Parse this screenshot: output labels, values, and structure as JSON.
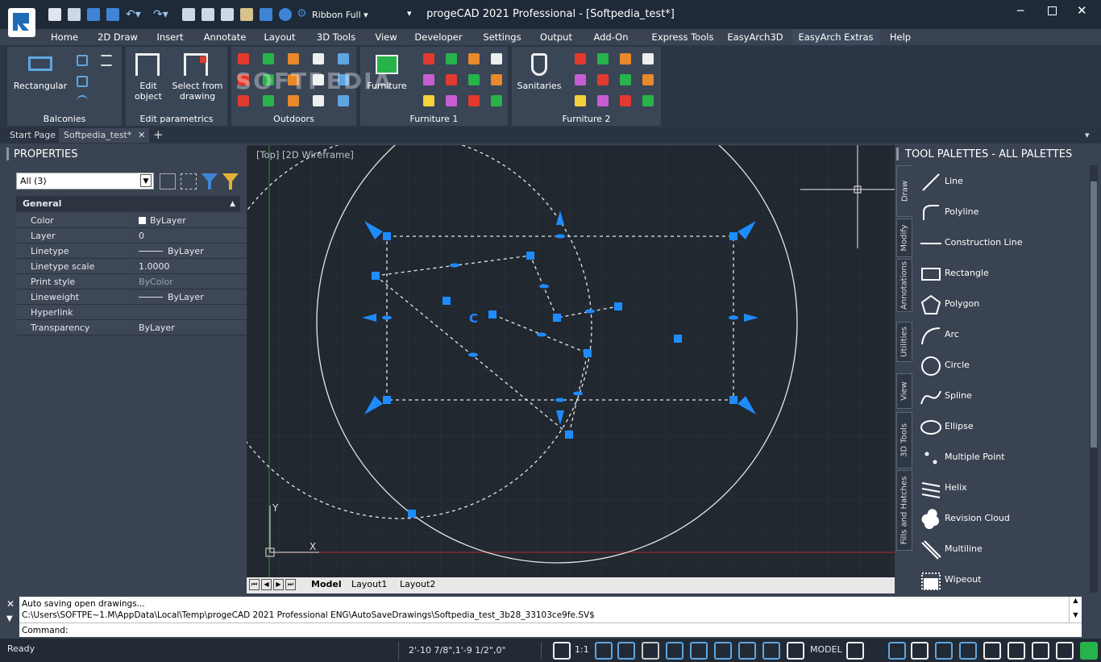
{
  "app": {
    "title": "progeCAD 2021 Professional - [Softpedia_test*]",
    "ribbon_mode": "Ribbon Full"
  },
  "menu": [
    "Home",
    "2D Draw",
    "Insert",
    "Annotate",
    "Layout",
    "3D Tools",
    "View",
    "Developer",
    "Settings",
    "Output",
    "Add-On",
    "Express Tools",
    "EasyArch3D",
    "EasyArch Extras",
    "Help"
  ],
  "ribbon": {
    "balconies": {
      "label": "Balconies",
      "big": "Rectangular"
    },
    "edit": {
      "label": "Edit parametrics",
      "b1": "Edit object",
      "b2": "Select from drawing"
    },
    "outdoors": {
      "label": "Outdoors"
    },
    "furn1": {
      "label": "Furniture 1",
      "big": "Furniture"
    },
    "furn2": {
      "label": "Furniture 2",
      "big": "Sanitaries"
    }
  },
  "watermark": "SOFTPEDIA",
  "doctabs": {
    "start": "Start Page",
    "doc": "Softpedia_test*"
  },
  "properties": {
    "title": "PROPERTIES",
    "selection": "All (3)",
    "section": "General",
    "rows": [
      {
        "k": "Color",
        "v": "ByLayer"
      },
      {
        "k": "Layer",
        "v": "0"
      },
      {
        "k": "Linetype",
        "v": "ByLayer"
      },
      {
        "k": "Linetype scale",
        "v": "1.0000"
      },
      {
        "k": "Print style",
        "v": "ByColor"
      },
      {
        "k": "Lineweight",
        "v": "ByLayer"
      },
      {
        "k": "Hyperlink",
        "v": ""
      },
      {
        "k": "Transparency",
        "v": "ByLayer"
      }
    ]
  },
  "viewport": {
    "label": "[Top] [2D Wireframe]",
    "y": "Y",
    "x": "X",
    "c": "C"
  },
  "layouts": [
    "Model",
    "Layout1",
    "Layout2"
  ],
  "palettes": {
    "title": "TOOL PALETTES - ALL PALETTES",
    "tabs": [
      "Draw",
      "Modify",
      "Annotations",
      "Utilities",
      "View",
      "3D Tools",
      "Fills and Hatches"
    ],
    "tools": [
      "Line",
      "Polyline",
      "Construction Line",
      "Rectangle",
      "Polygon",
      "Arc",
      "Circle",
      "Spline",
      "Ellipse",
      "Multiple Point",
      "Helix",
      "Revision Cloud",
      "Multiline",
      "Wipeout"
    ]
  },
  "command": {
    "line1": "Auto saving open drawings...",
    "line2": "C:\\Users\\SOFTPE~1.M\\AppData\\Local\\Temp\\progeCAD 2021 Professional ENG\\AutoSaveDrawings\\Softpedia_test_3b28_33103ce9fe.SV$",
    "prompt": "Command:"
  },
  "status": {
    "ready": "Ready",
    "coords": "2'-10 7/8\",1'-9 1/2\",0\"",
    "scale": "1:1",
    "space": "MODEL"
  }
}
